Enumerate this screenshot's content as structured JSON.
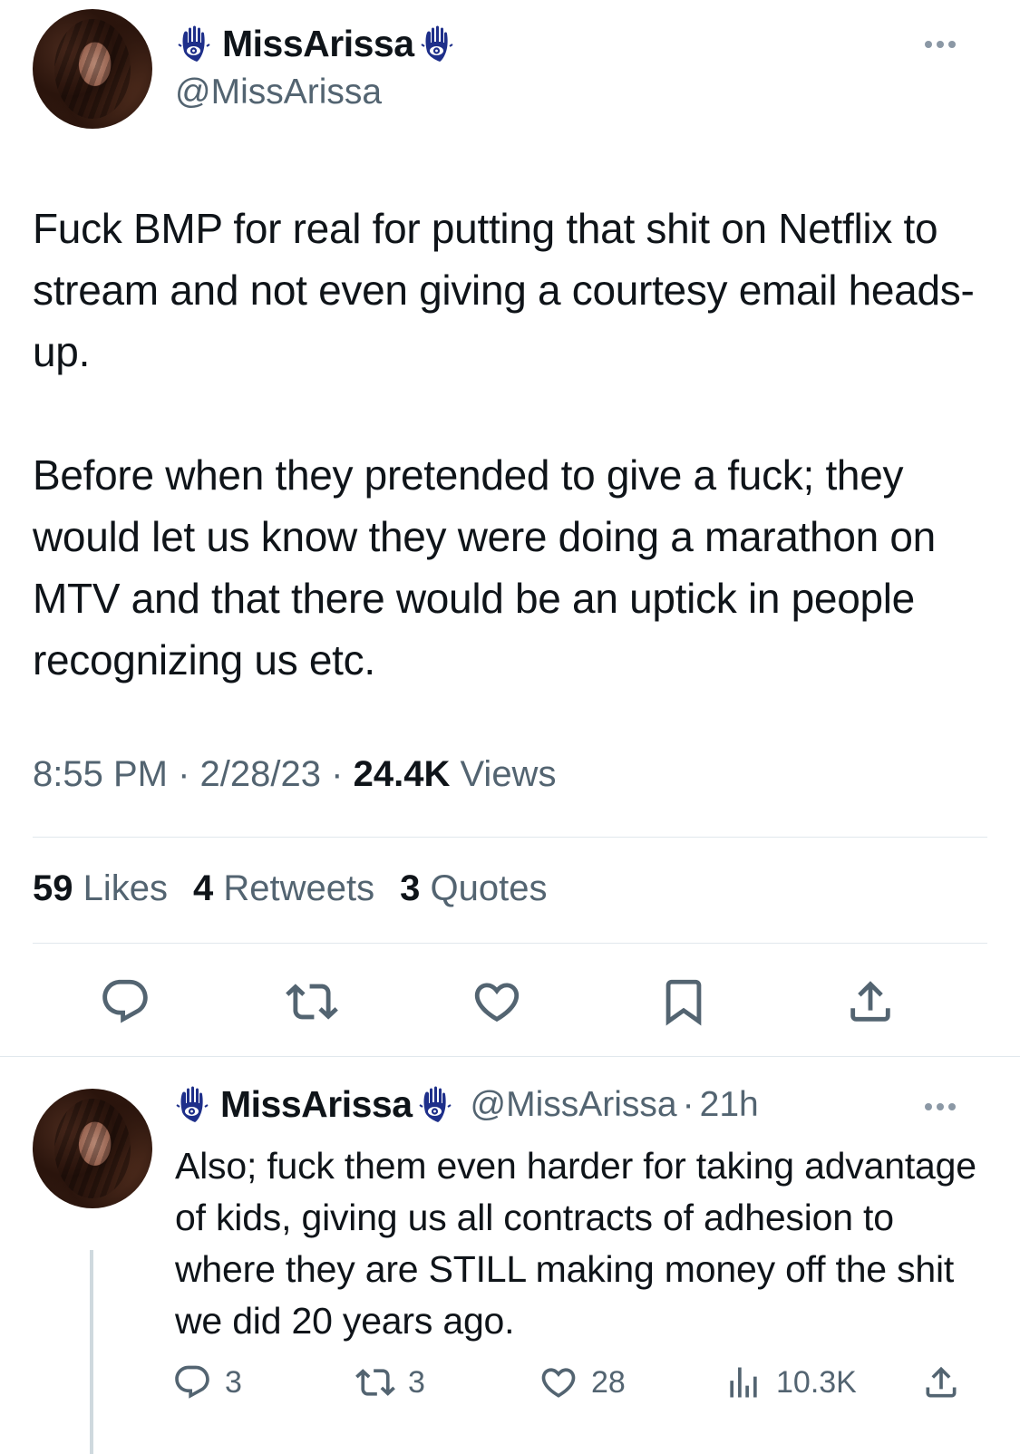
{
  "main_tweet": {
    "display_name": "MissArissa",
    "handle": "@MissArissa",
    "paragraphs": [
      "Fuck BMP for real for putting that shit on Netflix to stream and not even giving a courtesy email heads-up.",
      "Before when they pretended to give a fuck; they would let us know they were doing a marathon on MTV and that there would be an uptick in people recognizing us etc."
    ],
    "time": "8:55 PM",
    "date": "2/28/23",
    "separator": "·",
    "views_count": "24.4K",
    "views_label": "Views",
    "likes_count": "59",
    "likes_label": "Likes",
    "retweets_count": "4",
    "retweets_label": "Retweets",
    "quotes_count": "3",
    "quotes_label": "Quotes"
  },
  "reply_tweet": {
    "display_name": "MissArissa",
    "handle": "@MissArissa",
    "separator": "·",
    "age": "21h",
    "text": "Also; fuck them even harder for taking advantage of kids, giving us all contracts of adhesion to where they are STILL making money off the shit we did 20 years ago.",
    "replies": "3",
    "retweets": "3",
    "likes": "28",
    "views": "10.3K"
  },
  "colors": {
    "text": "#0f1419",
    "secondary": "#536471",
    "divider": "#e1e8ed",
    "hamsa_blue": "#1e2f8a"
  },
  "icons": [
    "hamsa-icon",
    "more-icon",
    "reply-icon",
    "retweet-icon",
    "like-icon",
    "bookmark-icon",
    "share-icon",
    "views-icon"
  ]
}
